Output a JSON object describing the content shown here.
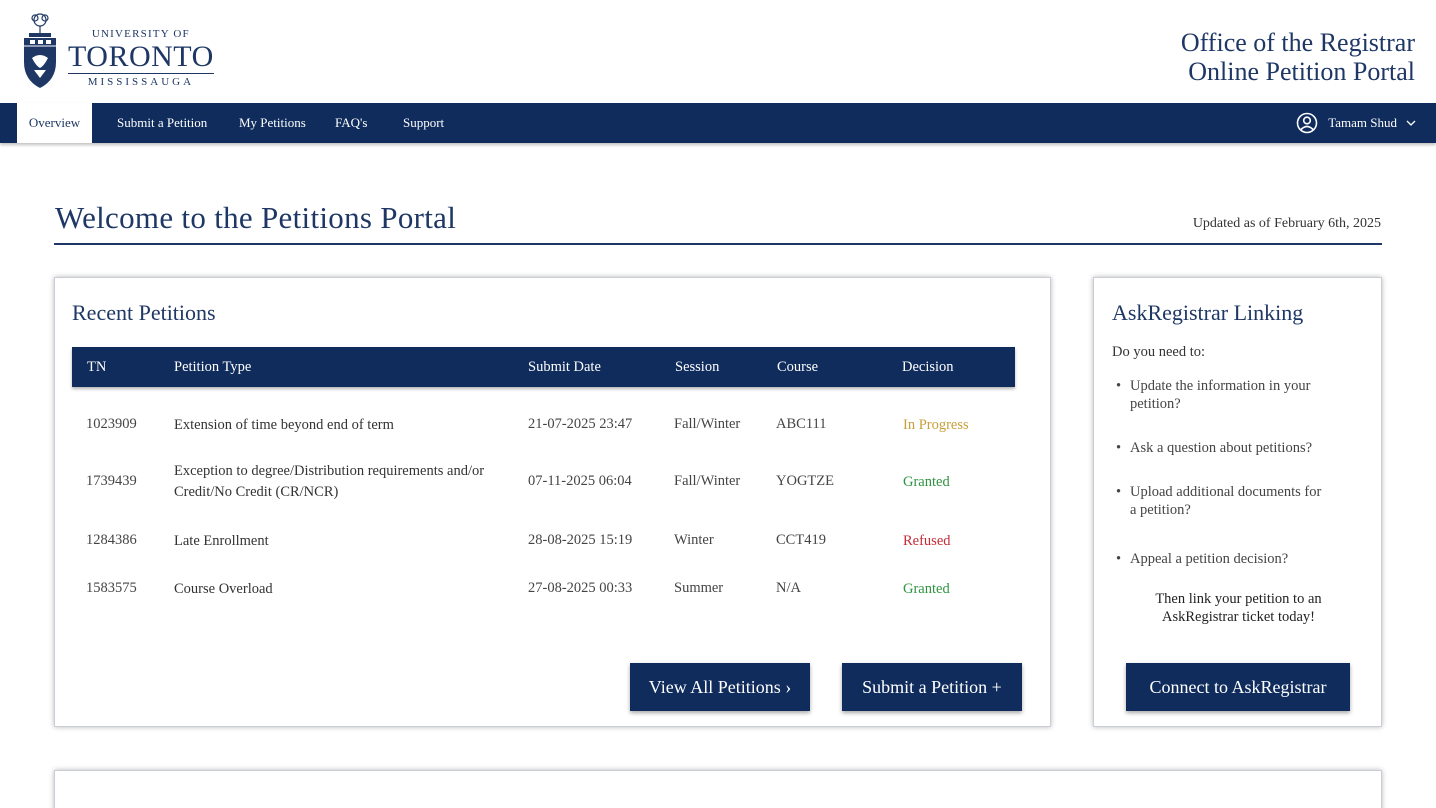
{
  "header": {
    "logo": {
      "line1": "UNIVERSITY OF",
      "line2": "TORONTO",
      "line3": "MISSISSAUGA"
    },
    "office_line1": "Office of the Registrar",
    "office_line2": "Online Petition Portal"
  },
  "nav": {
    "tabs": [
      {
        "label": "Overview",
        "active": true
      },
      {
        "label": "Submit a Petition"
      },
      {
        "label": "My Petitions"
      },
      {
        "label": "FAQ's"
      },
      {
        "label": "Support"
      }
    ],
    "user_name": "Tamam Shud"
  },
  "welcome": {
    "title": "Welcome to the Petitions Portal",
    "updated": "Updated as of February 6th, 2025"
  },
  "recent": {
    "title": "Recent Petitions",
    "columns": [
      "TN",
      "Petition Type",
      "Submit Date",
      "Session",
      "Course",
      "Decision"
    ],
    "rows": [
      {
        "tn": "1023909",
        "type": "Extension of time beyond end of term",
        "date": "21-07-2025 23:47",
        "session": "Fall/Winter",
        "course": "ABC111",
        "decision": "In Progress"
      },
      {
        "tn": "1739439",
        "type": "Exception to degree/Distribution requirements and/or Credit/No Credit (CR/NCR)",
        "date": "07-11-2025 06:04",
        "session": "Fall/Winter",
        "course": "YOGTZE",
        "decision": "Granted"
      },
      {
        "tn": "1284386",
        "type": "Late Enrollment",
        "date": "28-08-2025 15:19",
        "session": "Winter",
        "course": "CCT419",
        "decision": "Refused"
      },
      {
        "tn": "1583575",
        "type": "Course Overload",
        "date": "27-08-2025 00:33",
        "session": "Summer",
        "course": "N/A",
        "decision": "Granted"
      }
    ],
    "view_all_label": "View All Petitions ›",
    "submit_label": "Submit a Petition +"
  },
  "ask": {
    "title": "AskRegistrar Linking",
    "subtitle": "Do you need to:",
    "items": [
      "Update the information in your petition?",
      "Ask a question about petitions?",
      "Upload additional documents for a petition?",
      "Appeal a petition decision?"
    ],
    "then_line1": "Then link your petition to an",
    "then_line2": "AskRegistrar ticket today!",
    "button_label": "Connect to AskRegistrar"
  },
  "colors": {
    "navy": "#0f2c5c",
    "title_blue": "#1e3765",
    "in_progress": "#c8a03a",
    "granted": "#2e9440",
    "refused": "#c42b35"
  }
}
